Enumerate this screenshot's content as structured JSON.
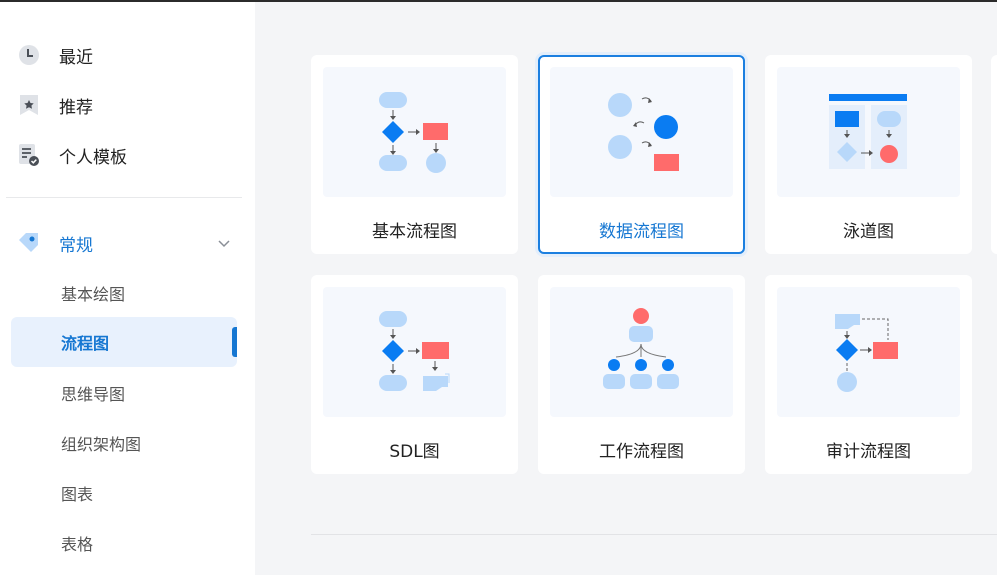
{
  "sidebar": {
    "top_items": [
      {
        "label": "最近",
        "icon": "clock-icon"
      },
      {
        "label": "推荐",
        "icon": "star-bookmark-icon"
      },
      {
        "label": "个人模板",
        "icon": "personal-template-icon"
      }
    ],
    "section": {
      "label": "常规",
      "icon": "tag-icon",
      "expanded": true
    },
    "sub_items": [
      {
        "label": "基本绘图",
        "active": false
      },
      {
        "label": "流程图",
        "active": true
      },
      {
        "label": "思维导图",
        "active": false
      },
      {
        "label": "组织架构图",
        "active": false
      },
      {
        "label": "图表",
        "active": false
      },
      {
        "label": "表格",
        "active": false
      }
    ]
  },
  "cards": [
    {
      "label": "基本流程图",
      "selected": false
    },
    {
      "label": "数据流程图",
      "selected": true
    },
    {
      "label": "泳道图",
      "selected": false
    },
    {
      "label": "SDL图",
      "selected": false
    },
    {
      "label": "工作流程图",
      "selected": false
    },
    {
      "label": "审计流程图",
      "selected": false
    }
  ],
  "colors": {
    "accent": "#1677d2",
    "shape_blue": "#0a7cf2",
    "shape_light": "#b8d8fa",
    "shape_red": "#ff6b6b"
  }
}
